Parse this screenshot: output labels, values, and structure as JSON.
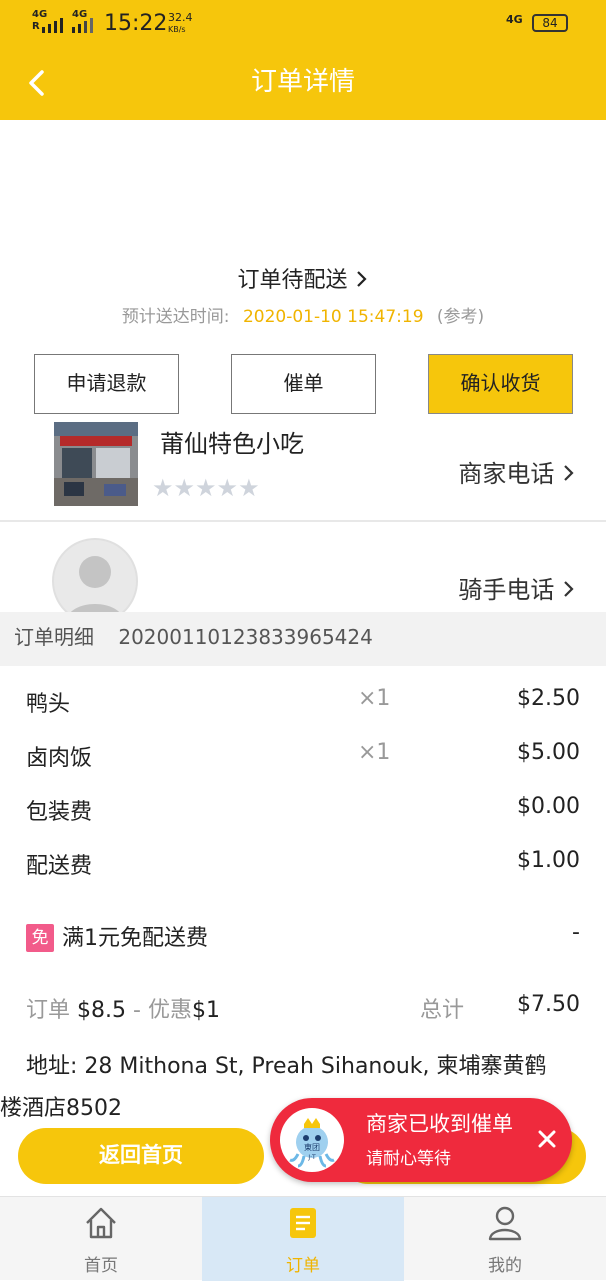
{
  "status_bar": {
    "sig1": "4G",
    "sig1b": "R",
    "sig2": "4G",
    "time": "15:22",
    "speed_value": "32.4",
    "speed_unit": "KB/s",
    "network": "4G",
    "battery": "84"
  },
  "header": {
    "title": "订单详情"
  },
  "order": {
    "status": "订单待配送",
    "eta_label": "预计送达时间:",
    "eta_time": "2020-01-10 15:47:19",
    "eta_note": "(参考)"
  },
  "actions": {
    "refund": "申请退款",
    "urge": "催单",
    "confirm": "确认收货"
  },
  "shop": {
    "name": "莆仙特色小吃",
    "stars": "★★★★★",
    "phone_link": "商家电话"
  },
  "rider": {
    "phone_link": "骑手电话"
  },
  "detail": {
    "label": "订单明细",
    "order_id": "20200110123833965424"
  },
  "items": [
    {
      "name": "鸭头",
      "qty": "×1",
      "price": "$2.50"
    },
    {
      "name": "卤肉饭",
      "qty": "×1",
      "price": "$5.00"
    },
    {
      "name": "包装费",
      "qty": "",
      "price": "$0.00"
    },
    {
      "name": "配送费",
      "qty": "",
      "price": "$1.00"
    }
  ],
  "promo": {
    "badge": "免",
    "text": "满1元免配送费",
    "value": "-"
  },
  "totals": {
    "order_label": "订单",
    "order_value": "$8.5",
    "sep": "-",
    "discount_label": "优惠",
    "discount_value": "$1",
    "total_label": "总计",
    "total_value": "$7.50"
  },
  "address": {
    "label": "地址:",
    "line1": "28 Mithona St, Preah Sihanouk, 柬埔寨黄鹤",
    "line2": "楼酒店8502"
  },
  "bottom": {
    "home_button": "返回首页"
  },
  "toast": {
    "title": "商家已收到催单",
    "subtitle": "请耐心等待",
    "logo_text": "東团",
    "logo_sub": "J·T"
  },
  "tabs": [
    {
      "label": "首页",
      "icon": "home-icon"
    },
    {
      "label": "订单",
      "icon": "order-icon"
    },
    {
      "label": "我的",
      "icon": "user-icon"
    }
  ],
  "colors": {
    "brand_yellow": "#f6c60c",
    "eta_orange": "#f0b400",
    "toast_red": "#ef2a3d",
    "badge_pink": "#f25b8a"
  }
}
